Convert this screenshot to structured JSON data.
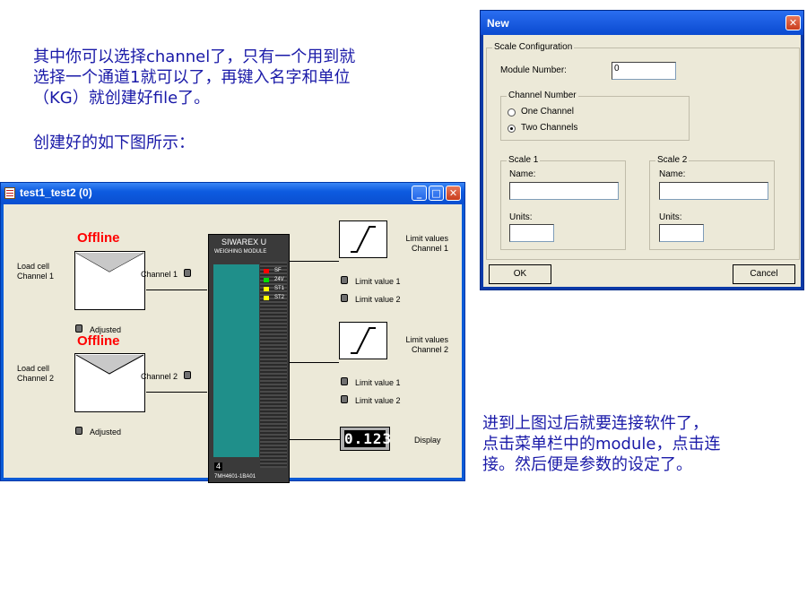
{
  "text_top": {
    "lines": [
      "其中你可以选择channel了，只有一个用到就",
      "选择一个通道1就可以了，再键入名字和单位",
      "（KG）就创建好file了。"
    ]
  },
  "text_mid": "创建好的如下图所示：",
  "text_bottom": {
    "lines": [
      "进到上图过后就要连接软件了，",
      "点击菜单栏中的module，点击连",
      "接。然后便是参数的设定了。"
    ]
  },
  "window": {
    "title": "test1_test2 (0)",
    "channels": [
      {
        "status": "Offline",
        "load_cell_label": [
          "Load cell",
          "Channel 1"
        ],
        "channel_label": "Channel 1",
        "adjusted_label": "Adjusted"
      },
      {
        "status": "Offline",
        "load_cell_label": [
          "Load cell",
          "Channel 2"
        ],
        "channel_label": "Channel 2",
        "adjusted_label": "Adjusted"
      }
    ],
    "module": {
      "brand": "SIWAREX U",
      "subtitle": "WEIGHING MODULE",
      "leds": [
        {
          "label": "SF",
          "color": "#ff0000"
        },
        {
          "label": "24V",
          "color": "#00dd00"
        },
        {
          "label": "ST1",
          "color": "#ffff00"
        },
        {
          "label": "ST2",
          "color": "#ffff00"
        }
      ],
      "slot": "4",
      "order_number": "7MH4601-1BA01"
    },
    "limits": [
      {
        "title": [
          "Limit values",
          "Channel 1"
        ],
        "values": [
          "Limit value 1",
          "Limit value 2"
        ]
      },
      {
        "title": [
          "Limit values",
          "Channel 2"
        ],
        "values": [
          "Limit value 1",
          "Limit value 2"
        ]
      }
    ],
    "display_label": "Display",
    "display_value": "0.123"
  },
  "dialog": {
    "title": "New",
    "scale_config_label": "Scale Configuration",
    "module_number_label": "Module Number:",
    "module_number_value": "0",
    "channel_number_label": "Channel Number",
    "radio_one": "One Channel",
    "radio_two": "Two Channels",
    "selected": "Two Channels",
    "scale1": {
      "label": "Scale 1",
      "name_label": "Name:",
      "units_label": "Units:"
    },
    "scale2": {
      "label": "Scale 2",
      "name_label": "Name:",
      "units_label": "Units:"
    },
    "ok": "OK",
    "cancel": "Cancel"
  }
}
